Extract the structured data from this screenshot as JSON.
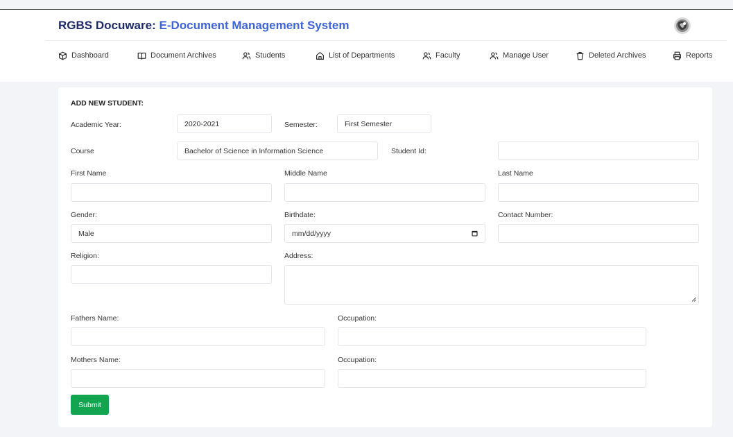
{
  "app": {
    "brand_strong": "RGBS Docuware:",
    "brand_title": "E-Document Management System"
  },
  "nav": {
    "items": [
      {
        "label": "Dashboard",
        "icon": "cube-icon"
      },
      {
        "label": "Document Archives",
        "icon": "book-open-icon"
      },
      {
        "label": "Students",
        "icon": "users-icon"
      },
      {
        "label": "List of Departments",
        "icon": "home-icon"
      },
      {
        "label": "Faculty",
        "icon": "users-icon"
      },
      {
        "label": "Manage User",
        "icon": "users-icon"
      },
      {
        "label": "Deleted Archives",
        "icon": "trash-icon"
      },
      {
        "label": "Reports",
        "icon": "printer-icon"
      }
    ]
  },
  "form": {
    "title": "ADD NEW STUDENT:",
    "academic_year_label": "Academic Year:",
    "academic_year_value": "2020-2021",
    "semester_label": "Semester:",
    "semester_value": "First Semester",
    "course_label": "Course",
    "course_value": "Bachelor of Science in Information Science",
    "student_id_label": "Student Id:",
    "student_id_value": "",
    "first_name_label": "First Name",
    "middle_name_label": "Middle Name",
    "last_name_label": "Last Name",
    "gender_label": "Gender:",
    "gender_value": "Male",
    "birthdate_label": "Birthdate:",
    "birthdate_placeholder": "mm/dd/yyyy",
    "contact_label": "Contact Number:",
    "religion_label": "Religion:",
    "address_label": "Address:",
    "fathers_name_label": "Fathers Name:",
    "father_occupation_label": "Occupation:",
    "mothers_name_label": "Mothers Name:",
    "mother_occupation_label": "Occupation:",
    "submit_label": "Submit"
  },
  "colors": {
    "brand_dark": "#1f2a6b",
    "brand_accent": "#3f63d9",
    "submit": "#12a44f"
  }
}
